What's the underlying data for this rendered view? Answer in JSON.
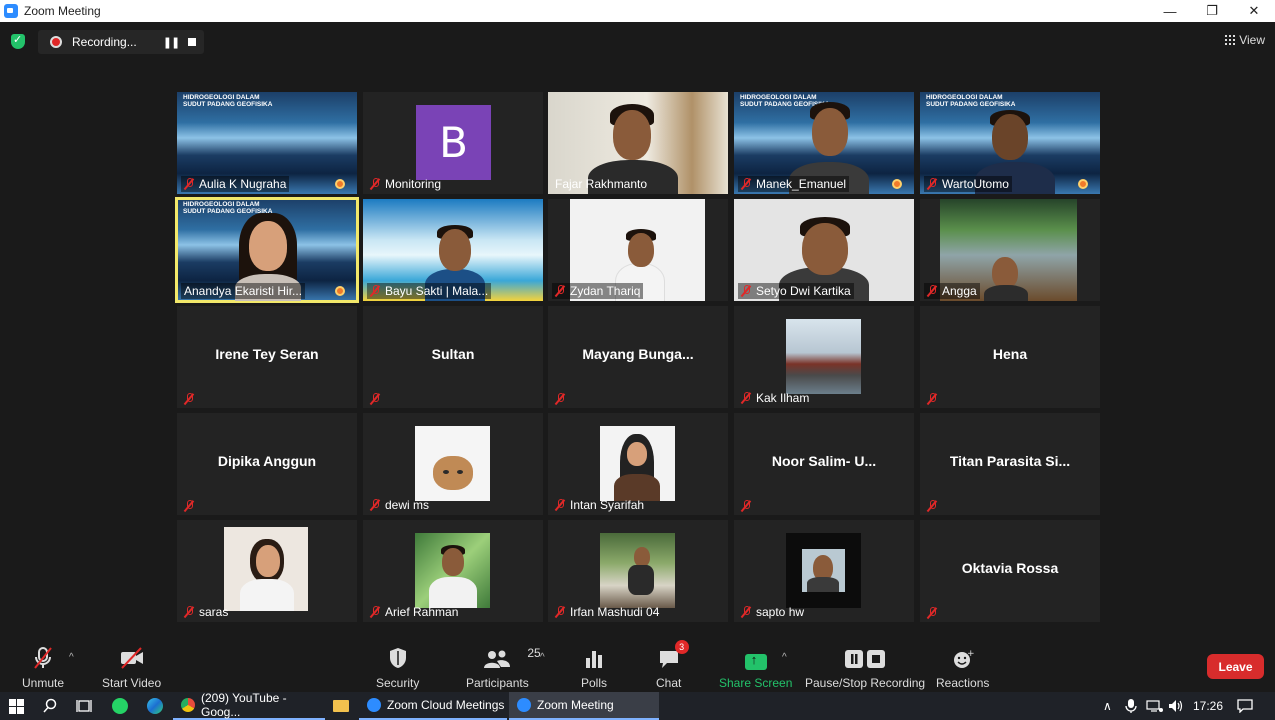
{
  "window": {
    "title": "Zoom Meeting",
    "controls": [
      "—",
      "❐",
      "✕"
    ]
  },
  "recording": {
    "label": "Recording...",
    "pause": "❚❚"
  },
  "view": {
    "label": "View"
  },
  "tiles": {
    "t0": "Aulia K Nugraha",
    "t1": "Monitoring",
    "t1_initial": "B",
    "t2": "Fajar Rakhmanto",
    "t3": "Manek_Emanuel",
    "t4": "WartoUtomo",
    "t5": "Anandya Ekaristi Hir...",
    "t6": "Bayu Sakti | Mala...",
    "t7": "Zydan Thariq",
    "t8": "Setyo Dwi Kartika",
    "t9": "Angga",
    "t10": "Irene Tey Seran",
    "t11": "Sultan",
    "t12": "Mayang  Bunga...",
    "t13": "Kak Ilham",
    "t14": "Hena",
    "t15": "Dipika Anggun",
    "t16": "dewi ms",
    "t17": "Intan Syarifah",
    "t18": "Noor Salim-  U...",
    "t19": "Titan  Parasita Si...",
    "t20": "saras",
    "t21": "Arief Rahman",
    "t22": "Irfan Mashudi 04",
    "t23": "sapto hw",
    "t24": "Oktavia Rossa"
  },
  "banner": {
    "line1": "HIDROGEOLOGI DALAM",
    "line2": "SUDUT PADANG GEOFISIKA"
  },
  "toolbar": {
    "unmute": "Unmute",
    "start_video": "Start Video",
    "security": "Security",
    "participants": "Participants",
    "participants_count": "25",
    "polls": "Polls",
    "chat": "Chat",
    "chat_badge": "3",
    "share_screen": "Share Screen",
    "pause_stop": "Pause/Stop Recording",
    "reactions": "Reactions",
    "leave": "Leave",
    "caret": "^"
  },
  "taskbar": {
    "app1": "(209) YouTube - Goog...",
    "app2": "Zoom Cloud Meetings",
    "app3": "Zoom Meeting",
    "time": "17:26",
    "tray": "∧"
  },
  "colors": {
    "mute_red": "#e02828",
    "share_green": "#23c26a",
    "leave_red": "#d82c2c",
    "active_speaker": "#f2e86a"
  }
}
